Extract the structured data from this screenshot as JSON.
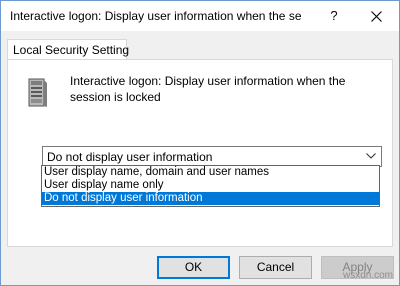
{
  "window": {
    "title": "Interactive logon: Display user information when the se",
    "help_glyph": "?",
    "close_icon": "close-icon"
  },
  "tabs": [
    {
      "label": "Local Security Setting",
      "active": true
    }
  ],
  "policy": {
    "icon": "server-icon",
    "description": "Interactive logon: Display user information when the session is locked"
  },
  "combobox": {
    "value": "Do not display user information",
    "arrow_icon": "chevron-down-icon"
  },
  "dropdown": {
    "options": [
      {
        "label": "User display name, domain and user names",
        "selected": false
      },
      {
        "label": "User display name only",
        "selected": false
      },
      {
        "label": "Do not display user information",
        "selected": true
      }
    ],
    "highlight_color": "#0078d7"
  },
  "buttons": {
    "ok": "OK",
    "cancel": "Cancel",
    "apply": "Apply"
  },
  "watermark": "wsxdn.com"
}
